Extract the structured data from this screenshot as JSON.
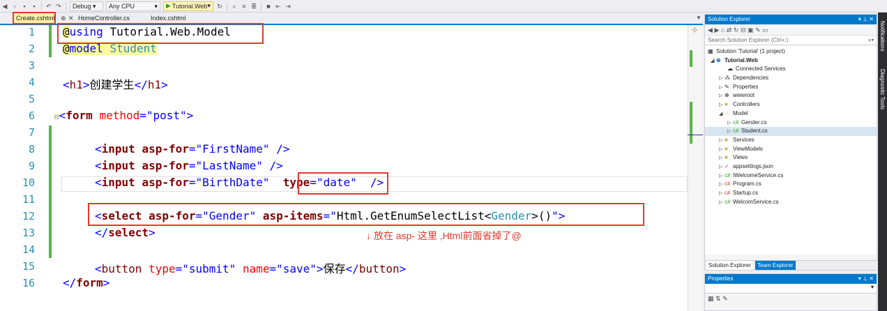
{
  "toolbar": {
    "debug": "Debug",
    "cpu": "Any CPU",
    "run_target": "Tutorial.Web"
  },
  "tabs": [
    {
      "label": "Create.cshtml"
    },
    {
      "label": "HomeController.cs"
    },
    {
      "label": "Index.cshtml"
    }
  ],
  "icons": {
    "pin": "pin-icon",
    "close": "close-icon",
    "play": "play-icon"
  },
  "code": {
    "line_numbers": [
      "1",
      "2",
      "3",
      "4",
      "5",
      "6",
      "7",
      "8",
      "9",
      "10",
      "11",
      "12",
      "13",
      "14",
      "15",
      "16"
    ],
    "l1": {
      "at": "@",
      "kw": "using",
      "ns": " Tutorial.Web.Model"
    },
    "l2": {
      "at": "@",
      "kw": "model",
      "ty": "Student"
    },
    "l4": {
      "open": "<",
      "tag": "h1",
      "close": ">",
      "text": "创建学生",
      "etag_open": "</",
      "etag": "h1",
      "etag_close": ">"
    },
    "l6": {
      "fold": "⊟",
      "open": "<",
      "tag": "form",
      "attr": "method",
      "eq": "=",
      "val": "\"post\"",
      "close": ">"
    },
    "l8": {
      "open": "<",
      "tag": "input",
      "attr": "asp-for",
      "eq": "=",
      "val": "\"FirstName\"",
      "close": " />"
    },
    "l9": {
      "open": "<",
      "tag": "input",
      "attr": "asp-for",
      "eq": "=",
      "val": "\"LastName\"",
      "close": " />"
    },
    "l10": {
      "open": "<",
      "tag": "input",
      "attr": "asp-for",
      "eq": "=",
      "val": "\"BirthDate\"",
      "attr2": "type",
      "eq2": "=",
      "val2": "\"date\"",
      "close": " />"
    },
    "l12": {
      "open": "<",
      "tag": "select",
      "attr": "asp-for",
      "eq": "=",
      "val": "\"Gender\"",
      "attr2": "asp-items",
      "eq2": "=",
      "q1": "\"",
      "expr": "Html.GetEnumSelectList<",
      "ty": "Gender",
      "expr2": ">()",
      "q2": "\"",
      "close": ">"
    },
    "l13": {
      "open": "</",
      "tag": "select",
      "close": ">"
    },
    "l15": {
      "open": "<",
      "tag": "button",
      "attr": "type",
      "eq": "=",
      "val": "\"submit\"",
      "attr2": "name",
      "eq2": "=",
      "val2": "\"save\"",
      "close": ">",
      "text": "保存",
      "etag_open": "</",
      "etag": "button",
      "etag_close": ">"
    },
    "l16": {
      "open": "</",
      "tag": "form",
      "close": ">"
    }
  },
  "annotation": {
    "arrow": "↓",
    "text": "放在 asp- 这里 ,Html前面省掉了@"
  },
  "solution_explorer": {
    "title": "Solution Explorer",
    "search_placeholder": "Search Solution Explorer (Ctrl+;)",
    "tree": [
      {
        "label": "Solution 'Tutorial' (1 project)",
        "icon": "solution-icon"
      },
      {
        "label": "Tutorial.Web",
        "icon": "web-project-icon"
      },
      {
        "label": "Connected Services",
        "icon": "connected-services-icon"
      },
      {
        "label": "Dependencies",
        "icon": "dependencies-icon"
      },
      {
        "label": "Properties",
        "icon": "wrench-icon"
      },
      {
        "label": "wwwroot",
        "icon": "globe-icon"
      },
      {
        "label": "Controllers",
        "icon": "folder-icon"
      },
      {
        "label": "Model",
        "icon": "folder-open-icon"
      },
      {
        "label": "Gender.cs",
        "icon": "csharp-file-icon"
      },
      {
        "label": "Student.cs",
        "icon": "csharp-file-icon"
      },
      {
        "label": "Services",
        "icon": "folder-icon"
      },
      {
        "label": "ViewModels",
        "icon": "folder-icon"
      },
      {
        "label": "Views",
        "icon": "folder-icon"
      },
      {
        "label": "appsettings.json",
        "icon": "json-file-icon"
      },
      {
        "label": "IWelcomeService.cs",
        "icon": "csharp-file-icon"
      },
      {
        "label": "Program.cs",
        "icon": "csharp-file-icon"
      },
      {
        "label": "Startup.cs",
        "icon": "csharp-file-icon"
      },
      {
        "label": "WelcomService.cs",
        "icon": "csharp-file-icon"
      }
    ],
    "tabs": [
      "Solution Explorer",
      "Team Explorer"
    ]
  },
  "properties": {
    "title": "Properties"
  },
  "side_tabs": [
    "Notifications",
    "Diagnostic Tools"
  ]
}
